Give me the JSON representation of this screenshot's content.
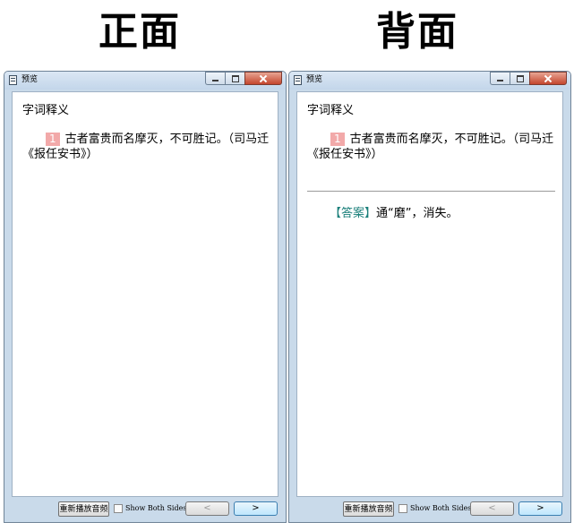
{
  "headings": {
    "front": "正面",
    "back": "背面"
  },
  "window": {
    "title": "预览",
    "section_title": "字词释义",
    "question_number": "1",
    "question_text": "古者富贵而名摩灭，不可胜记。（司马迁《报任安书》）",
    "answer_label": "【答案】",
    "answer_text": "通“磨”，消失。",
    "replay_button": "重新播放音频",
    "show_both_sides": "Show Both Sides",
    "prev_button": "<",
    "next_button": ">"
  }
}
